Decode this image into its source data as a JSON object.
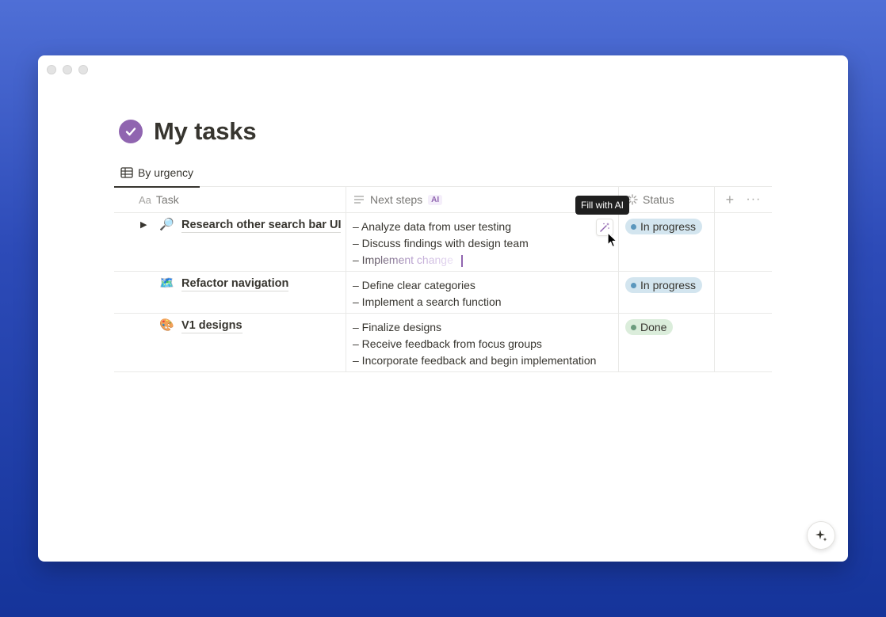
{
  "page": {
    "title": "My tasks"
  },
  "views": {
    "active": "By urgency"
  },
  "table": {
    "columns": {
      "task": "Task",
      "task_prefix": "Aa",
      "next_steps": "Next steps",
      "ai_badge": "AI",
      "status": "Status"
    },
    "rows": [
      {
        "task": "Research other search bar UI",
        "emoji": "🔎",
        "expand_icon": "▶",
        "steps": [
          "– Analyze data from user testing",
          "– Discuss findings with design team",
          "– Implement change"
        ],
        "status": "In progress",
        "status_color": "#d3e5ef"
      },
      {
        "task": "Refactor navigation",
        "emoji": "🗺️",
        "steps": [
          "– Define clear categories",
          "– Implement a search function"
        ],
        "status": "In progress",
        "status_color": "#d3e5ef"
      },
      {
        "task": "V1 designs",
        "emoji": "🎨",
        "steps": [
          "– Finalize designs",
          "– Receive feedback from focus groups",
          "– Incorporate feedback and begin implementation"
        ],
        "status": "Done",
        "status_color": "#dbeddb"
      }
    ]
  },
  "tooltip": {
    "text": "Fill with AI"
  },
  "colors": {
    "accent_purple": "#9065b0",
    "background_blue": "#2d4bb8"
  }
}
